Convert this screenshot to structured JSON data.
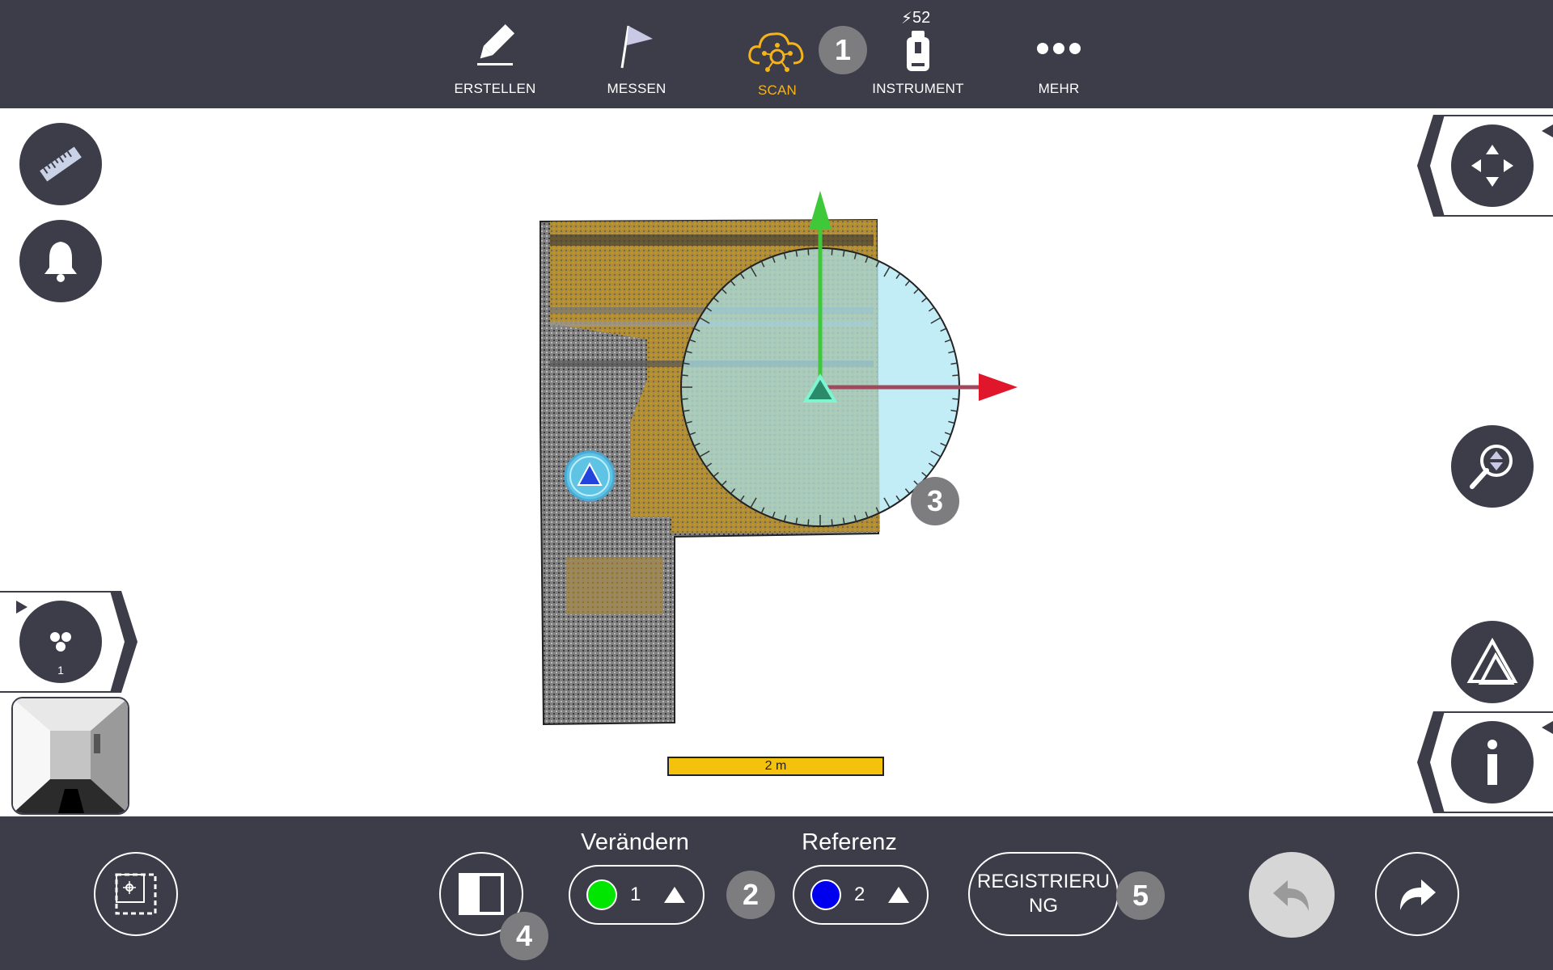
{
  "nav": {
    "items": [
      {
        "label": "ERSTELLEN",
        "icon": "pencil-icon"
      },
      {
        "label": "MESSEN",
        "icon": "flag-icon"
      },
      {
        "label": "SCAN",
        "icon": "scan-cloud-icon",
        "active": true
      },
      {
        "label": "INSTRUMENT",
        "icon": "instrument-icon"
      },
      {
        "label": "MEHR",
        "icon": "more-dots-icon"
      }
    ],
    "battery_value": "52"
  },
  "callouts": {
    "c1": "1",
    "c2": "2",
    "c3": "3",
    "c4": "4",
    "c5": "5"
  },
  "left_tools": {
    "ruler_icon": "ruler-icon",
    "bell_icon": "bell-icon",
    "layers_badge": "1"
  },
  "right_tools": {
    "move_icon": "move-arrows-icon",
    "zoom_icon": "zoom-icon",
    "station_icon": "station-triangle-icon",
    "info_icon": "info-icon"
  },
  "scale_bar": {
    "label": "2 m"
  },
  "bottom": {
    "change_label": "Verändern",
    "change_value": "1",
    "change_color": "#00e600",
    "reference_label": "Referenz",
    "reference_value": "2",
    "reference_color": "#0000ee",
    "register_label": "REGISTRIERUNG",
    "register_line1": "REGISTRIERU",
    "register_line2": "NG"
  },
  "colors": {
    "bar_bg": "#3d3c49",
    "accent": "#f4b41a",
    "callout": "#7d7d80"
  }
}
